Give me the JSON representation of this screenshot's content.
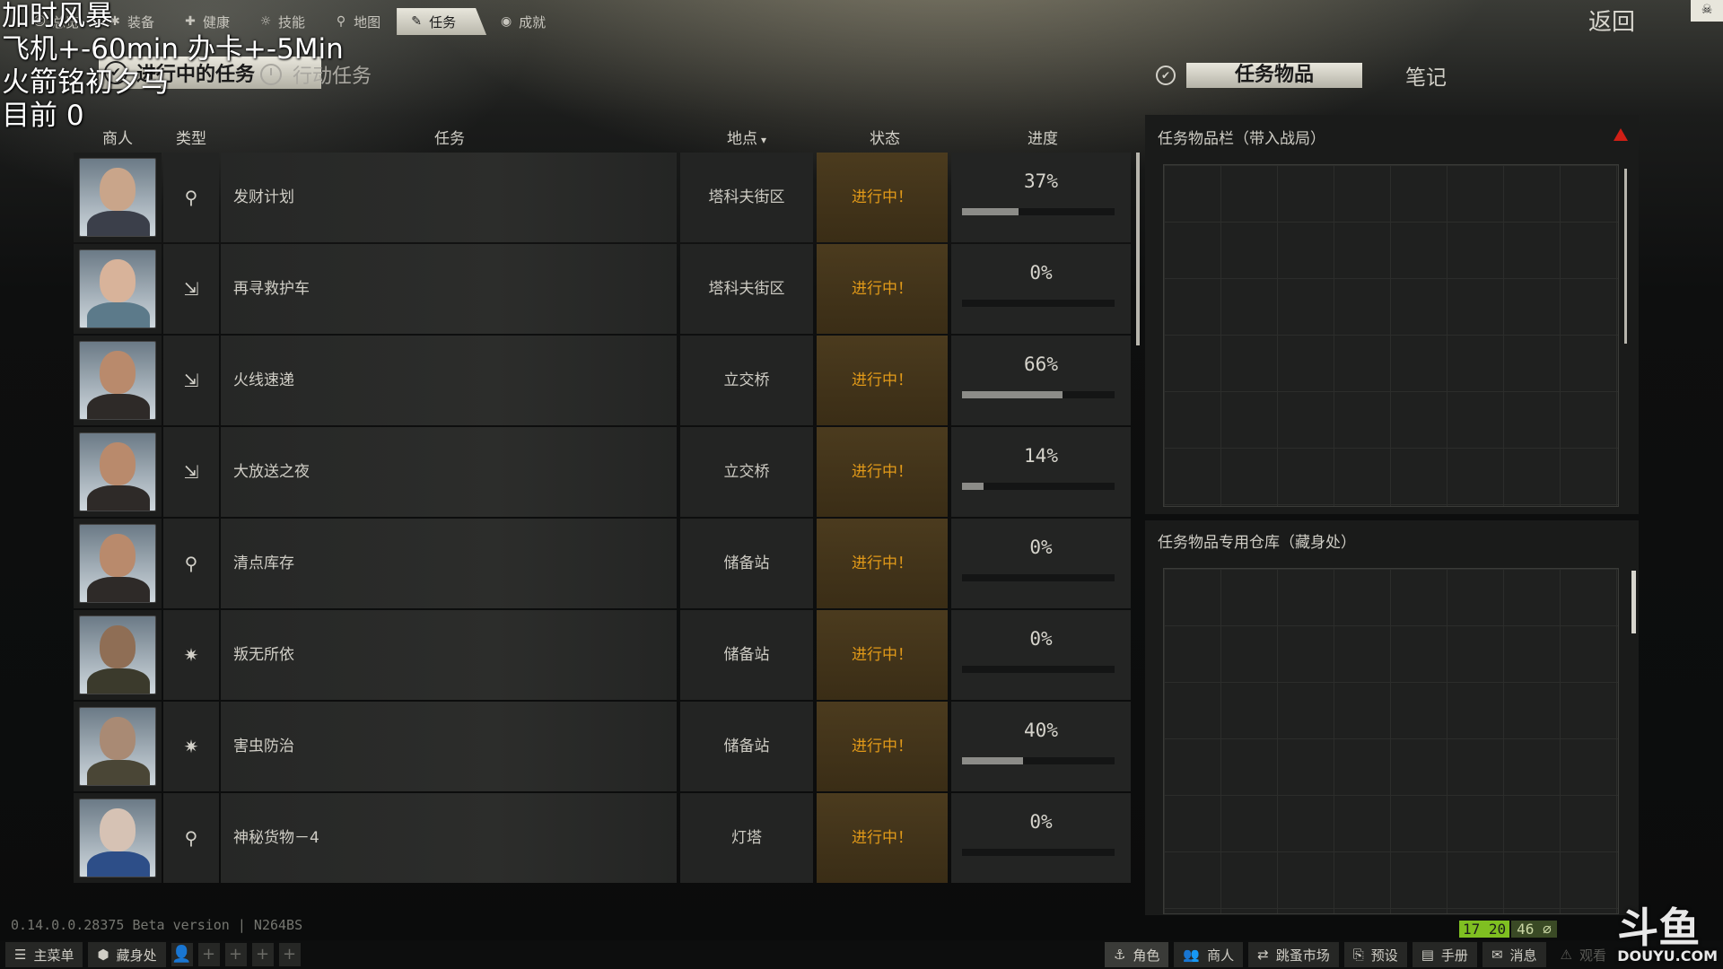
{
  "overlay": {
    "line1": "加时风暴",
    "line2": "飞机+-60min 办卡+-5Min",
    "line3": "火箭铭初夕马",
    "line4": "目前 0"
  },
  "nav": {
    "tabs": [
      {
        "label": "总览",
        "icon": "overview-icon"
      },
      {
        "label": "装备",
        "icon": "gear-icon"
      },
      {
        "label": "健康",
        "icon": "health-icon"
      },
      {
        "label": "技能",
        "icon": "skills-icon"
      },
      {
        "label": "地图",
        "icon": "map-pin-icon"
      },
      {
        "label": "任务",
        "icon": "edit-icon"
      },
      {
        "label": "成就",
        "icon": "achievement-icon"
      }
    ],
    "active_tab": "任务",
    "back": "返回"
  },
  "subtabs": {
    "in_progress": "进行中的任务",
    "operations": "行动任务",
    "quest_items": "任务物品",
    "notes": "笔记"
  },
  "table": {
    "headers": {
      "trader": "商人",
      "type": "类型",
      "task": "任务",
      "location": "地点",
      "status": "状态",
      "progress": "进度"
    },
    "rows": [
      {
        "task": "发财计划",
        "location": "塔科夫街区",
        "status": "进行中！",
        "progress": "37%",
        "fill": 0.37,
        "type_icon": "location-pin-icon"
      },
      {
        "task": "再寻救护车",
        "location": "塔科夫街区",
        "status": "进行中！",
        "progress": "0%",
        "fill": 0.0,
        "type_icon": "exit-icon"
      },
      {
        "task": "火线速递",
        "location": "立交桥",
        "status": "进行中！",
        "progress": "66%",
        "fill": 0.66,
        "type_icon": "exit-icon"
      },
      {
        "task": "大放送之夜",
        "location": "立交桥",
        "status": "进行中！",
        "progress": "14%",
        "fill": 0.14,
        "type_icon": "exit-icon"
      },
      {
        "task": "清点库存",
        "location": "储备站",
        "status": "进行中！",
        "progress": "0%",
        "fill": 0.0,
        "type_icon": "search-icon"
      },
      {
        "task": "叛无所依",
        "location": "储备站",
        "status": "进行中！",
        "progress": "0%",
        "fill": 0.0,
        "type_icon": "target-icon"
      },
      {
        "task": "害虫防治",
        "location": "储备站",
        "status": "进行中！",
        "progress": "40%",
        "fill": 0.4,
        "type_icon": "target-icon"
      },
      {
        "task": "神秘货物－4",
        "location": "灯塔",
        "status": "进行中！",
        "progress": "0%",
        "fill": 0.0,
        "type_icon": "location-pin-icon"
      }
    ]
  },
  "panels": {
    "raid_items_title": "任务物品栏（带入战局）",
    "stash_items_title": "任务物品专用仓库（藏身处）"
  },
  "footer": {
    "version": "0.14.0.0.28375 Beta version | N264BS",
    "page_a": "17 20",
    "page_b": "46"
  },
  "bottombar": {
    "left": [
      {
        "label": "主菜单",
        "icon": "menu-icon"
      },
      {
        "label": "藏身处",
        "icon": "hideout-icon"
      }
    ],
    "right": [
      {
        "label": "角色",
        "icon": "character-icon"
      },
      {
        "label": "商人",
        "icon": "traders-icon"
      },
      {
        "label": "跳蚤市场",
        "icon": "flea-market-icon"
      },
      {
        "label": "预设",
        "icon": "presets-icon"
      },
      {
        "label": "手册",
        "icon": "handbook-icon"
      },
      {
        "label": "消息",
        "icon": "messages-icon"
      },
      {
        "label": "观看",
        "icon": "warning-icon"
      }
    ]
  },
  "watermark": {
    "brand": "斗鱼",
    "site": "DOUYU.COM"
  }
}
